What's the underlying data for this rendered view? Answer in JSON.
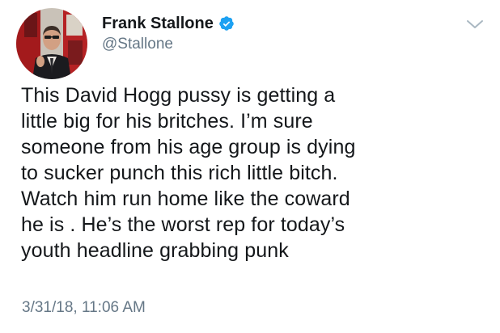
{
  "author": {
    "display_name": "Frank Stallone",
    "handle": "@Stallone",
    "verified": true
  },
  "tweet": {
    "lines": [
      "This David Hogg pussy is getting a",
      "little big for his britches. I’m sure",
      "someone from his age group is dying",
      "to sucker punch this rich little bitch.",
      "Watch him run home like the coward",
      "he is . He’s the worst rep for today’s",
      "youth headline grabbing punk"
    ],
    "timestamp": "3/31/18, 11:06 AM"
  },
  "colors": {
    "text": "#14171a",
    "secondary_text": "#657786",
    "verified_badge": "#1da1f2",
    "chevron": "#aab8c2"
  },
  "icons": {
    "verified": "verified-badge-icon",
    "menu": "chevron-down-icon"
  }
}
